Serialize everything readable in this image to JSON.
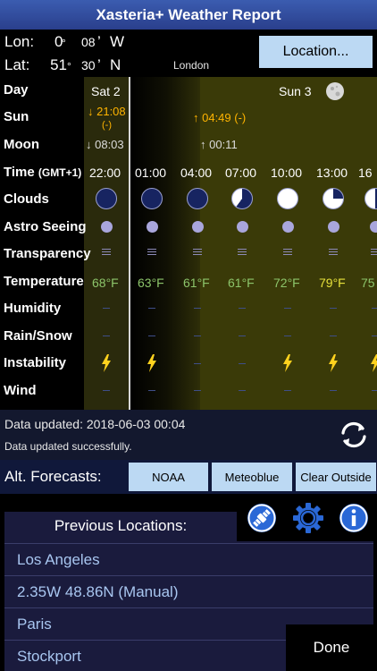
{
  "title": "Xasteria+ Weather Report",
  "coords": {
    "lon_label": "Lon:",
    "lon_deg": "0",
    "lon_min": "08",
    "lon_dir": "W",
    "lat_label": "Lat:",
    "lat_deg": "51",
    "lat_min": "30",
    "lat_dir": "N",
    "deg_mark": "°",
    "min_mark": "’"
  },
  "location_button": "Location...",
  "city": "London",
  "row_labels": {
    "day": "Day",
    "sun": "Sun",
    "moon": "Moon",
    "time": "Time",
    "time_tz": "(GMT+1)",
    "clouds": "Clouds",
    "seeing": "Astro Seeing",
    "transparency": "Transparency",
    "temperature": "Temperature",
    "humidity": "Humidity",
    "rain": "Rain/Snow",
    "instability": "Instability",
    "wind": "Wind"
  },
  "days": {
    "sat": "Sat 2",
    "sun": "Sun 3"
  },
  "sun": {
    "set": "↓ 21:08",
    "set_note": "(-)",
    "rise": "↑ 04:49 (-)"
  },
  "moon": {
    "set": "↓ 08:03",
    "rise": "↑ 00:11"
  },
  "times": [
    "22:00",
    "01:00",
    "04:00",
    "07:00",
    "10:00",
    "13:00",
    "16"
  ],
  "cloud_cover": [
    1.0,
    1.0,
    1.0,
    0.6,
    0.0,
    0.25,
    0.5
  ],
  "temperatures": [
    "68°F",
    "63°F",
    "61°F",
    "61°F",
    "72°F",
    "79°F",
    "75"
  ],
  "instability": [
    true,
    true,
    false,
    false,
    true,
    true,
    true
  ],
  "colors": {
    "sun_text": "#ffb400",
    "moon_text": "#dcdcdc",
    "temp_cool": "#8cc46a",
    "temp_warm": "#e6e03a",
    "bolt": "#ffd21e",
    "night": "#000000",
    "dusk": "#1c1c0a",
    "day": "#3a3a08",
    "button": "#bcd9f3"
  },
  "status": {
    "updated": "Data updated: 2018-06-03 00:04",
    "message": "Data updated successfully."
  },
  "alt_forecasts": {
    "label": "Alt. Forecasts:",
    "buttons": [
      "NOAA",
      "Meteoblue",
      "Clear Outside"
    ]
  },
  "previous": {
    "title": "Previous Locations:",
    "items": [
      "Los Angeles",
      "2.35W 48.86N (Manual)",
      "Paris",
      "Stockport"
    ]
  },
  "icons": [
    "satellite-icon",
    "gear-icon",
    "info-icon",
    "refresh-icon",
    "moon-phase-icon",
    "lightning-icon"
  ],
  "done_label": "Done"
}
